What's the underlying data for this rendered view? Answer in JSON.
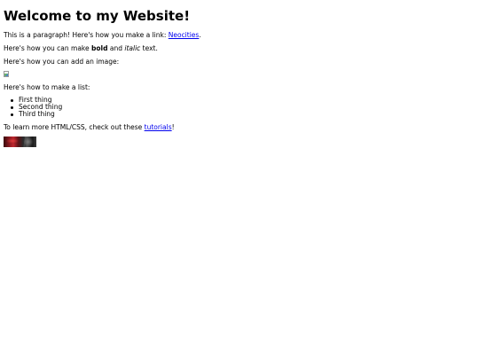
{
  "heading": "Welcome to my Website!",
  "para1": {
    "text": "This is a paragraph! Here's how you make a link: ",
    "link": "Neocities",
    "end": "."
  },
  "para2": {
    "start": "Here's how you can make ",
    "bold": "bold",
    "middle": " and ",
    "italic": "italic",
    "end": " text."
  },
  "para3": "Here's how you can add an image:",
  "para4": "Here's how to make a list:",
  "list": [
    "First thing",
    "Second thing",
    "Third thing"
  ],
  "para5": {
    "text": "To learn more HTML/CSS, check out these ",
    "link": "tutorials",
    "end": "!"
  },
  "colors": {
    "link": "#0000ee",
    "text": "#000000",
    "background": "#ffffff"
  }
}
